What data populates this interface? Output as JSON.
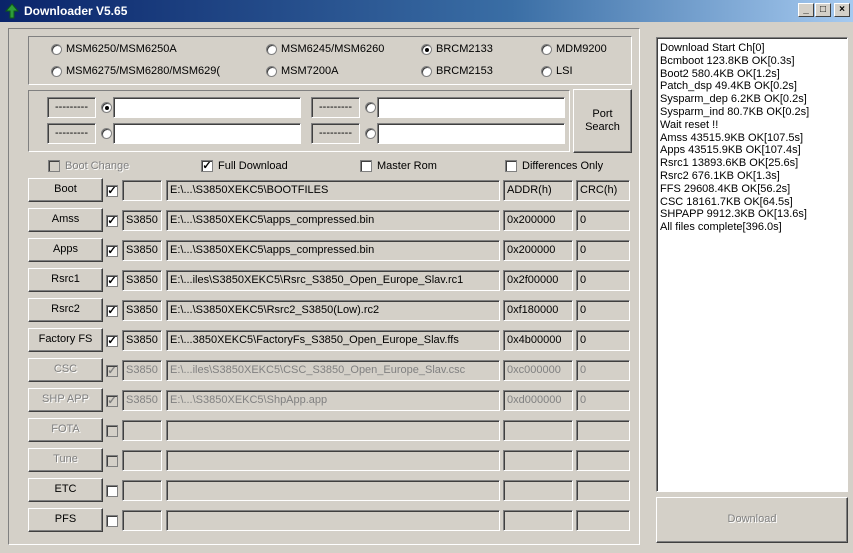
{
  "window": {
    "title": "Downloader V5.65"
  },
  "title_buttons": [
    "_",
    "□",
    "×"
  ],
  "chipsets": [
    {
      "label": "MSM6250/MSM6250A",
      "selected": false
    },
    {
      "label": "MSM6245/MSM6260",
      "selected": false
    },
    {
      "label": "BRCM2133",
      "selected": true
    },
    {
      "label": "MDM9200",
      "selected": false
    },
    {
      "label": "MSM6275/MSM6280/MSM629(",
      "selected": false
    },
    {
      "label": "MSM7200A",
      "selected": false
    },
    {
      "label": "BRCM2153",
      "selected": false
    },
    {
      "label": "LSI",
      "selected": false
    }
  ],
  "ports": [
    {
      "tag": "---------",
      "value": "",
      "selected": true
    },
    {
      "tag": "---------",
      "value": "",
      "selected": false
    },
    {
      "tag": "---------",
      "value": "",
      "selected": false
    },
    {
      "tag": "---------",
      "value": "",
      "selected": false
    }
  ],
  "port_search_label": "Port\nSearch",
  "options": [
    {
      "label": "Boot Change",
      "checked": false,
      "disabled": true
    },
    {
      "label": "Full Download",
      "checked": true,
      "disabled": false
    },
    {
      "label": "Master Rom",
      "checked": false,
      "disabled": false
    },
    {
      "label": "Differences Only",
      "checked": false,
      "disabled": false
    }
  ],
  "rows": [
    {
      "button": "Boot",
      "checked": true,
      "disabled": false,
      "model": "",
      "path": "E:\\...\\S3850XEKC5\\BOOTFILES",
      "addr": "ADDR(h)",
      "crc": "CRC(h)"
    },
    {
      "button": "Amss",
      "checked": true,
      "disabled": false,
      "model": "S3850",
      "path": "E:\\...\\S3850XEKC5\\apps_compressed.bin",
      "addr": "0x200000",
      "crc": "0"
    },
    {
      "button": "Apps",
      "checked": true,
      "disabled": false,
      "model": "S3850",
      "path": "E:\\...\\S3850XEKC5\\apps_compressed.bin",
      "addr": "0x200000",
      "crc": "0"
    },
    {
      "button": "Rsrc1",
      "checked": true,
      "disabled": false,
      "model": "S3850",
      "path": "E:\\...iles\\S3850XEKC5\\Rsrc_S3850_Open_Europe_Slav.rc1",
      "addr": "0x2f00000",
      "crc": "0"
    },
    {
      "button": "Rsrc2",
      "checked": true,
      "disabled": false,
      "model": "S3850",
      "path": "E:\\...\\S3850XEKC5\\Rsrc2_S3850(Low).rc2",
      "addr": "0xf180000",
      "crc": "0"
    },
    {
      "button": "Factory FS",
      "checked": true,
      "disabled": false,
      "model": "S3850",
      "path": "E:\\...3850XEKC5\\FactoryFs_S3850_Open_Europe_Slav.ffs",
      "addr": "0x4b00000",
      "crc": "0"
    },
    {
      "button": "CSC",
      "checked": true,
      "disabled": true,
      "model": "S3850",
      "path": "E:\\...iles\\S3850XEKC5\\CSC_S3850_Open_Europe_Slav.csc",
      "addr": "0xc000000",
      "crc": "0"
    },
    {
      "button": "SHP APP",
      "checked": true,
      "disabled": true,
      "model": "S3850",
      "path": "E:\\...\\S3850XEKC5\\ShpApp.app",
      "addr": "0xd000000",
      "crc": "0"
    },
    {
      "button": "FOTA",
      "checked": false,
      "disabled": true,
      "model": "",
      "path": "",
      "addr": "",
      "crc": ""
    },
    {
      "button": "Tune",
      "checked": false,
      "disabled": true,
      "model": "",
      "path": "",
      "addr": "",
      "crc": ""
    },
    {
      "button": "ETC",
      "checked": false,
      "disabled": false,
      "model": "",
      "path": "",
      "addr": "",
      "crc": ""
    },
    {
      "button": "PFS",
      "checked": false,
      "disabled": false,
      "model": "",
      "path": "",
      "addr": "",
      "crc": ""
    }
  ],
  "log_lines": [
    "Download Start Ch[0]",
    "Bcmboot 123.8KB OK[0.3s]",
    "Boot2 580.4KB OK[1.2s]",
    "Patch_dsp 49.4KB OK[0.2s]",
    "Sysparm_dep 6.2KB OK[0.2s]",
    "Sysparm_ind 80.7KB OK[0.2s]",
    "Wait reset !!",
    "Amss 43515.9KB OK[107.5s]",
    "Apps 43515.9KB OK[107.4s]",
    "Rsrc1 13893.6KB OK[25.6s]",
    "Rsrc2 676.1KB OK[1.3s]",
    "FFS 29608.4KB OK[56.2s]",
    "CSC 18161.7KB OK[64.5s]",
    "SHPAPP 9912.3KB OK[13.6s]",
    "All files complete[396.0s]"
  ],
  "download_label": "Download"
}
